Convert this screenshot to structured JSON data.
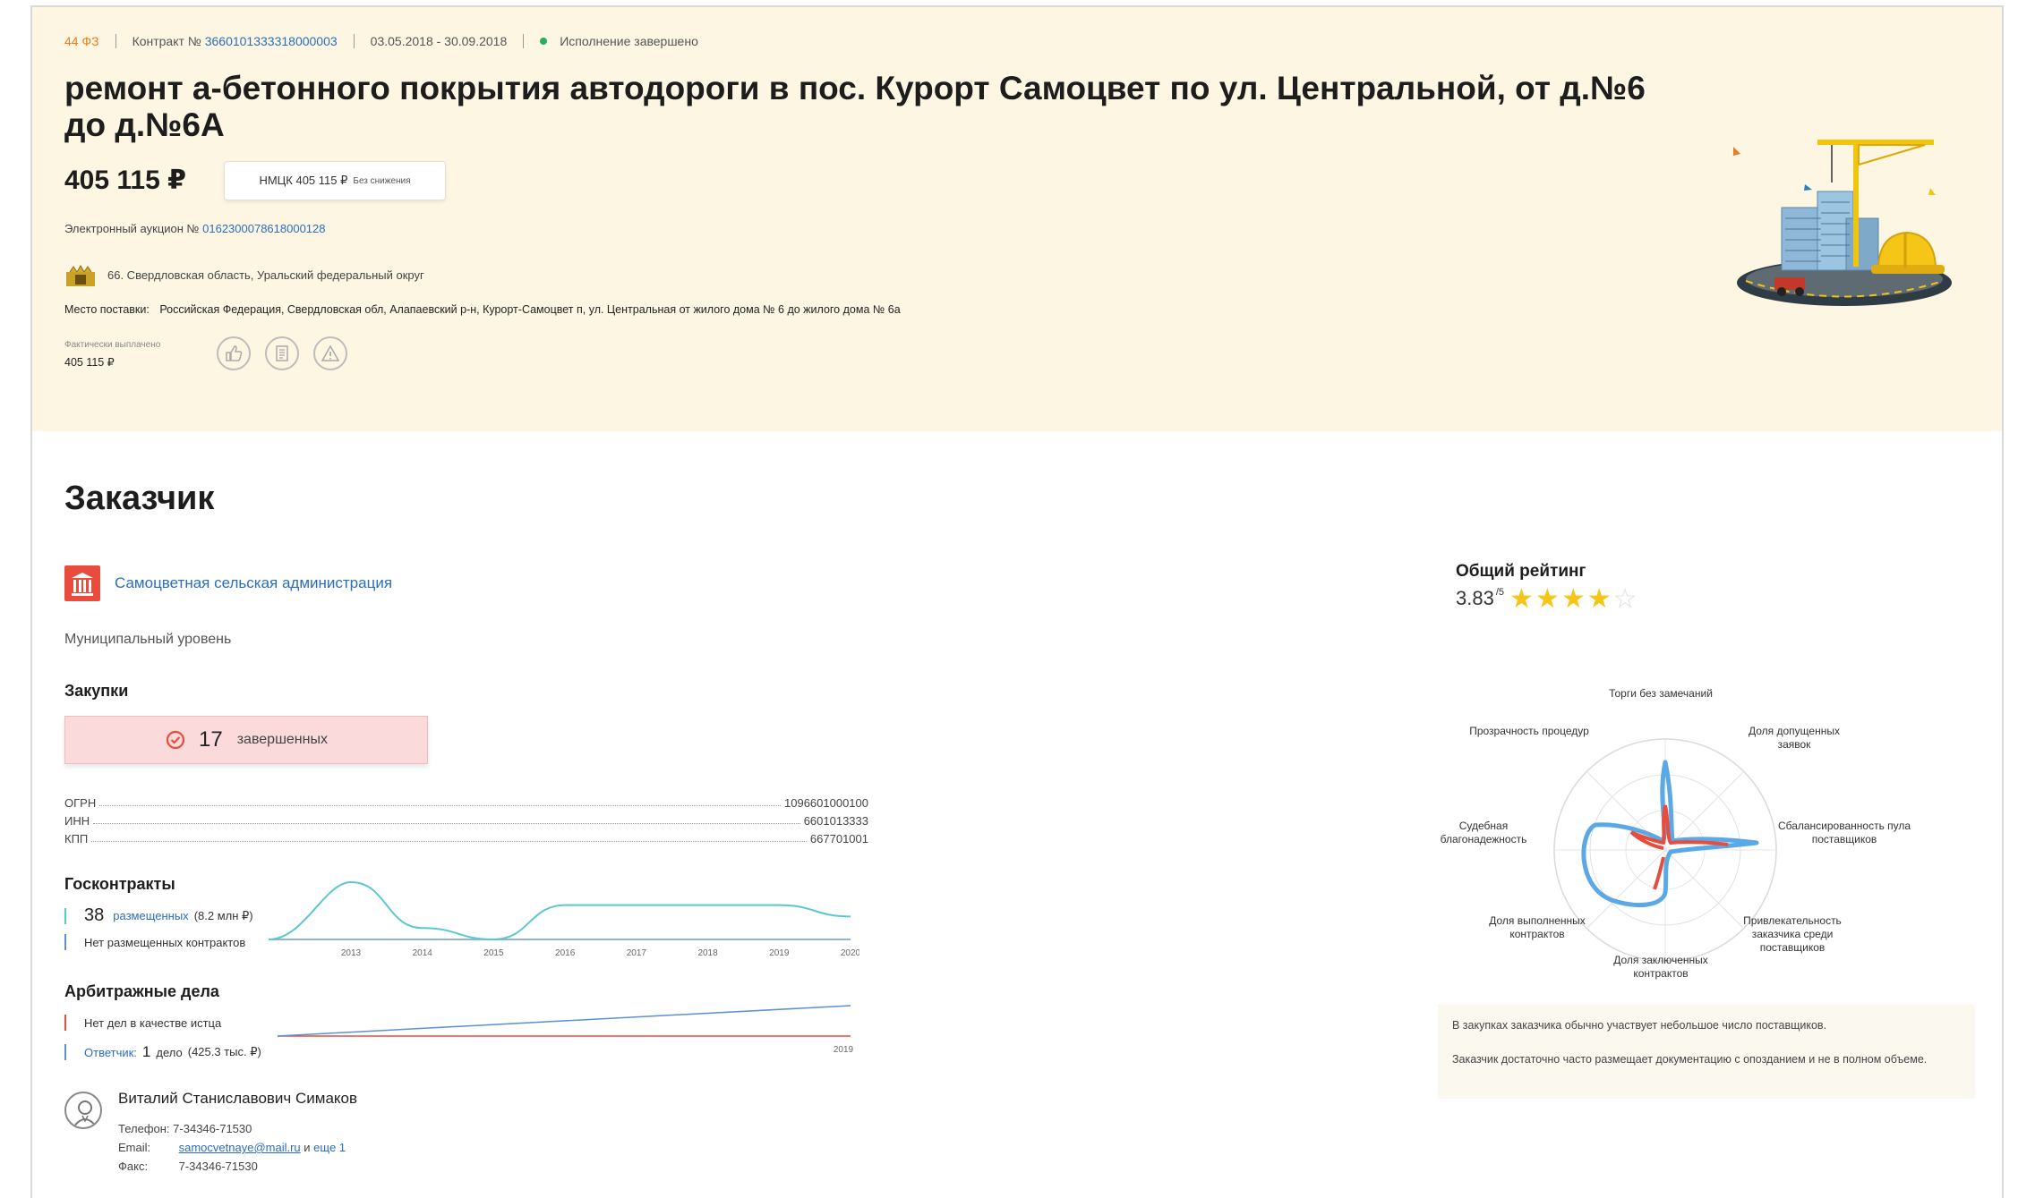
{
  "header": {
    "law": "44 ФЗ",
    "contract_label": "Контракт №",
    "contract_number": "3660101333318000003",
    "dates": "03.05.2018 - 30.09.2018",
    "status": "Исполнение завершено",
    "status_color": "#27ae60"
  },
  "tender": {
    "title": "ремонт а-бетонного покрытия автодороги в пос. Курорт Самоцвет по ул. Центральной, от д.№6 до д.№6А",
    "price": "405 115 ₽",
    "nmck_label": "НМЦК 405 115 ₽",
    "nmck_note": "Без снижения",
    "auction_label": "Электронный аукцион №",
    "auction_number": "0162300078618000128",
    "region": "66. Свердловская область, Уральский федеральный округ",
    "delivery_label": "Место поставки:",
    "delivery_place": "Российская Федерация, Свердловская обл, Алапаевский р-н, Курорт-Самоцвет п, ул. Центральная от жилого дома № 6 до жилого дома № 6а",
    "paid_label": "Фактически выплачено",
    "paid_value": "405 115 ₽",
    "action_icons": [
      "like-icon",
      "document-icon",
      "warning-icon"
    ]
  },
  "customer": {
    "section_title": "Заказчик",
    "name": "Самоцветная сельская администрация",
    "level": "Муниципальный уровень",
    "purchases_title": "Закупки",
    "completed_count": "17",
    "completed_label": "завершенных",
    "ids": [
      {
        "key": "ОГРН",
        "value": "1096601000100"
      },
      {
        "key": "ИНН",
        "value": "6601013333"
      },
      {
        "key": "КПП",
        "value": "667701001"
      }
    ],
    "contracts_title": "Госконтракты",
    "contracts_count": "38",
    "contracts_link": "размещенных",
    "contracts_sum": "(8.2 млн ₽)",
    "contracts_none": "Нет размещенных контрактов",
    "arbitrage_title": "Арбитражные дела",
    "arbitrage_plaintiff": "Нет дел в качестве истца",
    "arbitrage_defendant_link": "Ответчик:",
    "arbitrage_defendant_count": "1",
    "arbitrage_defendant_text": "дело",
    "arbitrage_defendant_sum": "(425.3 тыс. ₽)",
    "contact_name": "Виталий Станиславович Симаков",
    "phone_label": "Телефон:",
    "phone": "7-34346-71530",
    "email_label": "Email:",
    "email": "samocvetnaye@mail.ru",
    "email_more_and": "и",
    "email_more": "еще 1",
    "fax_label": "Факс:",
    "fax": "7-34346-71530"
  },
  "rating": {
    "title": "Общий рейтинг",
    "value": "3.83",
    "of": "/5",
    "stars_filled": 4,
    "stars_total": 5,
    "radar_labels": {
      "top": "Торги без замечаний",
      "top_right": "Доля допущенных заявок",
      "right": "Сбалансированность пула поставщиков",
      "bottom_right": "Привлекательность заказчика среди поставщиков",
      "bottom": "Доля заключенных контрактов",
      "bottom_left": "Доля выполненных контрактов",
      "left": "Судебная благонадежность",
      "top_left": "Прозрачность процедур"
    },
    "notes": [
      "В закупках заказчика обычно участвует небольшое число поставщиков.",
      "Заказчик достаточно часто размещает документацию с опозданием и не в полном объеме."
    ]
  },
  "chart_data": [
    {
      "type": "line",
      "x": [
        "2013",
        "2014",
        "2015",
        "2016",
        "2017",
        "2018",
        "2019",
        "2020"
      ],
      "series": [
        {
          "values": [
            5,
            1,
            0,
            3,
            3,
            3,
            3,
            2
          ]
        },
        {
          "values": [
            0,
            0,
            0,
            0,
            0,
            0,
            0,
            0
          ]
        }
      ],
      "colors": [
        "#5bc8cf",
        "#8fb3d9"
      ]
    },
    {
      "type": "line",
      "x": [
        "2019"
      ],
      "series": [
        {
          "values": [
            0,
            1
          ]
        },
        {
          "values": [
            0,
            0
          ]
        }
      ],
      "colors": [
        "#5b8fd6",
        "#e74c3c"
      ]
    }
  ]
}
